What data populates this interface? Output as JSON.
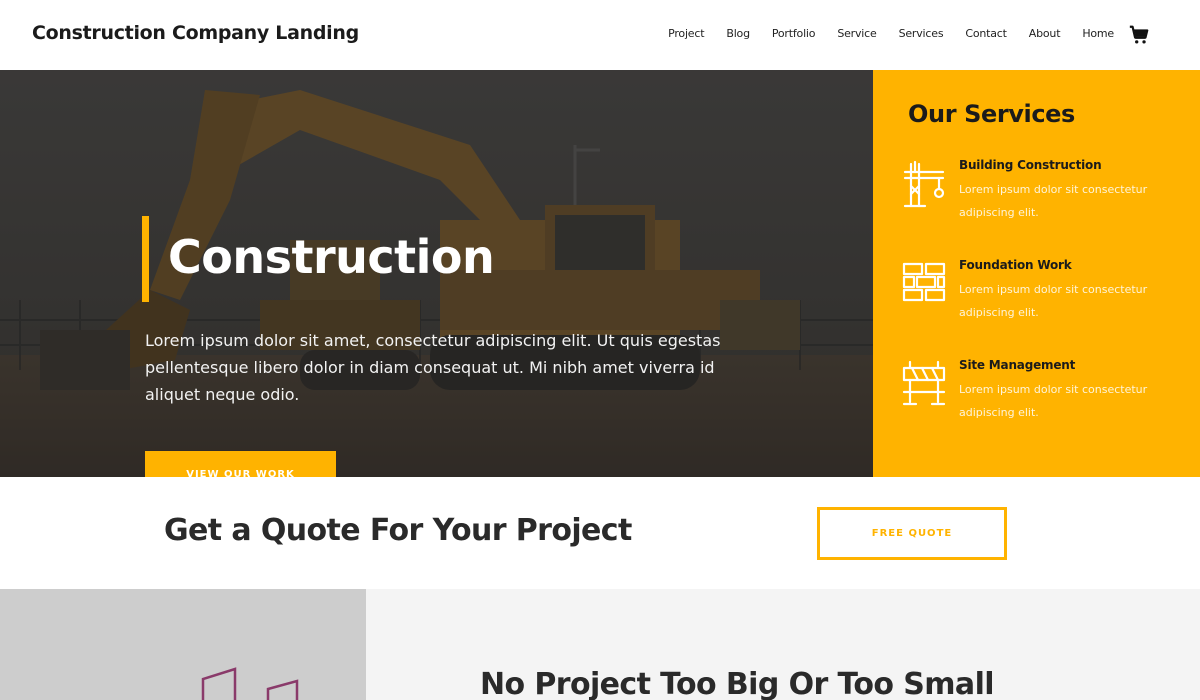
{
  "header": {
    "brand": "Construction Company Landing",
    "nav": [
      "Project",
      "Blog",
      "Portfolio",
      "Service",
      "Services",
      "Contact",
      "About",
      "Home"
    ],
    "cart_icon": "shopping-cart-icon"
  },
  "hero": {
    "title": "Construction",
    "text": "Lorem ipsum dolor sit amet, consectetur adipiscing elit. Ut quis egestas pellentesque libero dolor in diam consequat ut. Mi nibh amet viverra id aliquet neque odio.",
    "button": "VIEW OUR WORK",
    "background_image": "excavator-photo"
  },
  "services": {
    "title": "Our Services",
    "items": [
      {
        "icon": "crane-icon",
        "title": "Building Construction",
        "desc": "Lorem ipsum dolor sit consectetur adipiscing elit."
      },
      {
        "icon": "bricks-icon",
        "title": "Foundation Work",
        "desc": "Lorem ipsum dolor sit consectetur adipiscing elit."
      },
      {
        "icon": "barrier-icon",
        "title": "Site Management",
        "desc": "Lorem ipsum dolor sit consectetur adipiscing elit."
      }
    ]
  },
  "quote": {
    "title": "Get a Quote For Your Project",
    "button": "FREE QUOTE"
  },
  "bottom": {
    "title": "No Project Too Big Or Too Small"
  },
  "colors": {
    "accent": "#ffb300",
    "dark_text": "#1b1b1b",
    "hero_bg": "#3c3a38"
  }
}
